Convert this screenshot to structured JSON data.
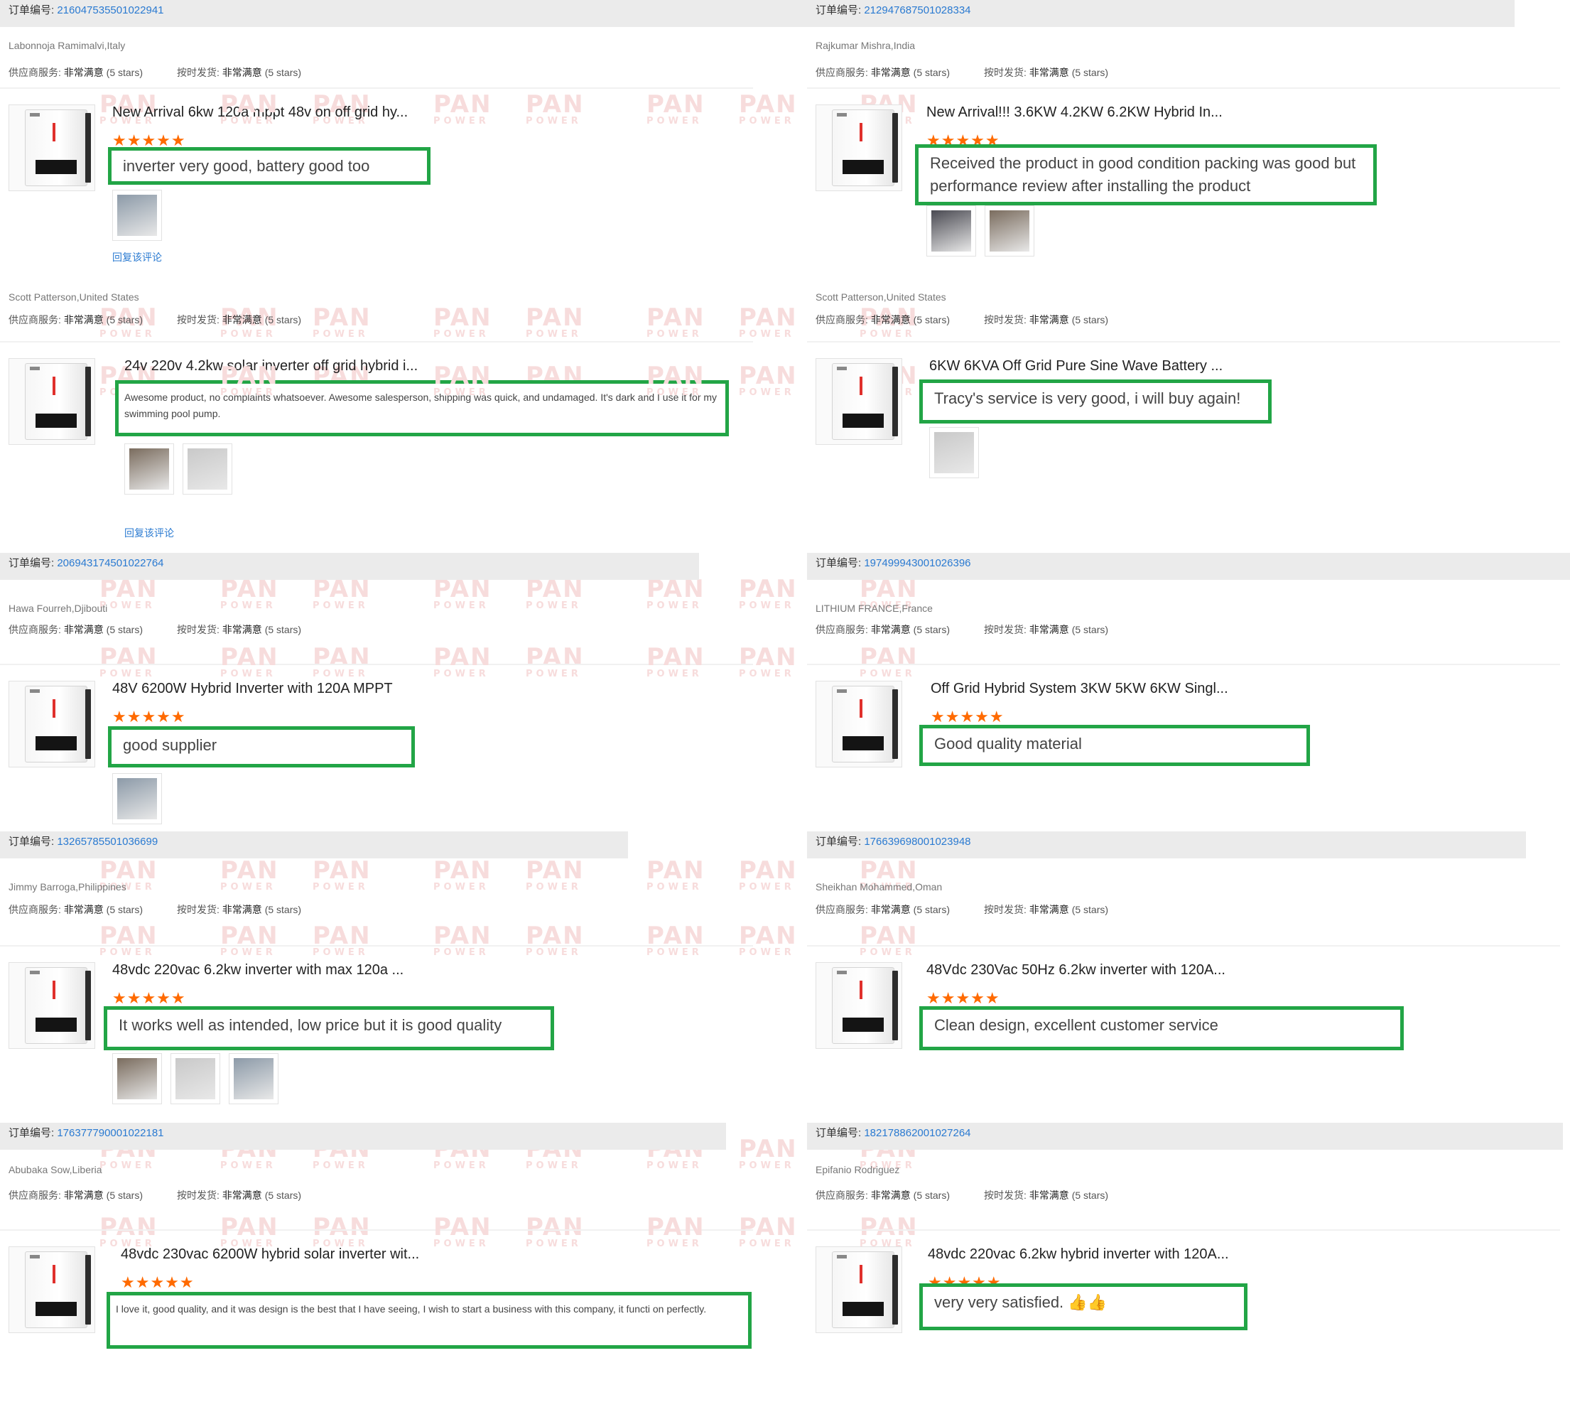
{
  "labels": {
    "order_label": "订单编号:",
    "supplier_service": "供应商服务:",
    "on_time": "按时发货:",
    "rating_value": "非常满意",
    "stars_suffix": "(5 stars)",
    "reply": "回复该评论",
    "stars": "★★★★★",
    "watermark_top": "PAN",
    "watermark_bottom": "POWER"
  },
  "colors": {
    "highlight_box": "#22a546",
    "star": "#ff6a00",
    "link": "#2a7ad1",
    "order_bar": "#ebebeb"
  },
  "reviews": [
    {
      "id": "r1",
      "order": "216047535501022941",
      "reviewer": "Labonnoja Ramimalvi,Italy",
      "title": "New Arrival 6kw 120a mppt 48v on off grid hy...",
      "review": "inverter very good, battery good too",
      "photos": 1,
      "reply": true
    },
    {
      "id": "r2",
      "order": "212947687501028334",
      "reviewer": "Rajkumar Mishra,India",
      "title": "New Arrival!!! 3.6KW 4.2KW 6.2KW Hybrid In...",
      "review": "Received the product in good condition packing was good but performance review after installing the product",
      "photos": 2,
      "reply": false
    },
    {
      "id": "r3",
      "order": "",
      "reviewer": "Scott Patterson,United States",
      "title": "24v 220v 4.2kw solar inverter off grid hybrid i...",
      "review": "Awesome product, no complaints whatsoever. Awesome salesperson, shipping was quick, and undamaged. It's dark and I use it for my swimming pool pump.",
      "photos": 2,
      "reply": true
    },
    {
      "id": "r4",
      "order": "",
      "reviewer": "Scott Patterson,United States",
      "title": "6KW 6KVA Off Grid Pure Sine Wave Battery ...",
      "review": "Tracy's service is very good, i will buy again!",
      "photos": 1,
      "reply": false
    },
    {
      "id": "r5",
      "order": "206943174501022764",
      "reviewer": "Hawa Fourreh,Djibouti",
      "title": "48V 6200W Hybrid Inverter with 120A MPPT",
      "review": "good supplier",
      "photos": 1,
      "reply": false
    },
    {
      "id": "r6",
      "order": "197499943001026396",
      "reviewer": "LITHIUM FRANCE,France",
      "title": "Off Grid Hybrid System 3KW 5KW 6KW Singl...",
      "review": "Good quality material",
      "photos": 0,
      "reply": false
    },
    {
      "id": "r7",
      "order": "132657855010366 99",
      "reviewer": "Jimmy Barroga,Philippines",
      "title": "48vdc 220vac 6.2kw inverter with max 120a ...",
      "review": "It works well as intended, low price but it is good quality",
      "photos": 3,
      "reply": false
    },
    {
      "id": "r8",
      "order": "176639698001023948",
      "reviewer": "Sheikhan Mohammed,Oman",
      "title": "48Vdc 230Vac 50Hz 6.2kw inverter with 120A...",
      "review": "Clean design, excellent customer service",
      "photos": 0,
      "reply": false
    },
    {
      "id": "r9",
      "order": "176377790001022181",
      "reviewer": "Abubaka Sow,Liberia",
      "title": "48vdc 230vac 6200W hybrid solar inverter wit...",
      "review": "I love it, good quality, and it was design is the best that I have seeing,  I wish to start a business with this company, it functi on perfectly.",
      "photos": 0,
      "reply": false
    },
    {
      "id": "r10",
      "order": "182178862001027264",
      "reviewer": "Epifanio Rodriguez",
      "title": "48vdc 220vac 6.2kw hybrid inverter with 120A...",
      "review": "very very satisfied. 👍👍",
      "photos": 0,
      "reply": false
    }
  ]
}
